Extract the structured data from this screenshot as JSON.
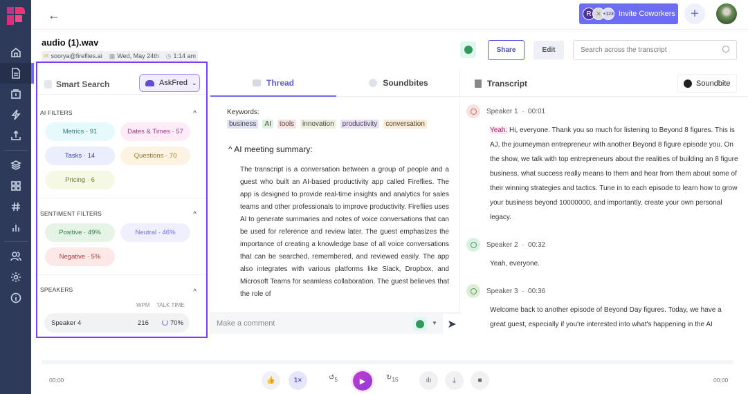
{
  "app": {
    "brand": "Fireflies",
    "accent": "#6c6cf5"
  },
  "sidebar": {
    "items": [
      {
        "name": "home",
        "active": false
      },
      {
        "name": "notebook",
        "active": true
      },
      {
        "name": "meetings",
        "active": false
      },
      {
        "name": "integrations",
        "active": false
      },
      {
        "name": "upload",
        "active": false
      },
      {
        "name": "layers",
        "active": false
      },
      {
        "name": "apps",
        "active": false
      },
      {
        "name": "topics",
        "active": false
      },
      {
        "name": "analytics",
        "active": false
      },
      {
        "name": "team",
        "active": false
      },
      {
        "name": "settings",
        "active": false
      },
      {
        "name": "info",
        "active": false
      }
    ]
  },
  "topbar": {
    "invite_label": "Invite Coworkers",
    "avatar_initial": "R",
    "extra_count": "+123",
    "plus_label": "+"
  },
  "meeting": {
    "title": "audio (1).wav",
    "email": "soorya@fireflies.ai",
    "date": "Wed, May 24th",
    "time": "1:14 am"
  },
  "actions": {
    "share_label": "Share",
    "edit_label": "Edit",
    "search_placeholder": "Search across the transcript"
  },
  "smart_search": {
    "title": "Smart Search",
    "askfred_label": "AskFred",
    "ai_filters_title": "AI FILTERS",
    "ai_filters": [
      {
        "label": "Metrics · 91",
        "bg": "#e6fafc",
        "fg": "#2b7a7a"
      },
      {
        "label": "Dates & Times · 57",
        "bg": "#fdebf8",
        "fg": "#a0338a"
      },
      {
        "label": "Tasks · 14",
        "bg": "#ebeefc",
        "fg": "#3a4aa0"
      },
      {
        "label": "Questions · 70",
        "bg": "#fdf3e3",
        "fg": "#a0762a"
      },
      {
        "label": "Pricing · 6",
        "bg": "#f5f9e3",
        "fg": "#6f7a2a"
      }
    ],
    "sentiment_title": "SENTIMENT FILTERS",
    "sentiment_filters": [
      {
        "label": "Positive · 49%",
        "bg": "#e6f4e8",
        "fg": "#2f7a3f"
      },
      {
        "label": "Neutral · 46%",
        "bg": "#efeffd",
        "fg": "#6c6cf5"
      },
      {
        "label": "Negative · 5%",
        "bg": "#fde8e8",
        "fg": "#b03a3a"
      }
    ],
    "speakers_title": "SPEAKERS",
    "col_wpm": "WPM",
    "col_talk": "TALK TIME",
    "speakers": [
      {
        "name": "Speaker 4",
        "wpm": "216",
        "talk_time": "70%"
      }
    ]
  },
  "thread": {
    "tab_thread": "Thread",
    "tab_soundbites": "Soundbites",
    "keywords_label": "Keywords:",
    "keywords": [
      {
        "text": "business",
        "bg": "#dfe2f2"
      },
      {
        "text": "AI",
        "bg": "#dcf2df"
      },
      {
        "text": "tools",
        "bg": "#fbe0e0"
      },
      {
        "text": "innovation",
        "bg": "#eef0dd"
      },
      {
        "text": "productivity",
        "bg": "#ebe0f7"
      },
      {
        "text": "conversation",
        "bg": "#fcebd2"
      }
    ],
    "summary_heading": "^ AI meeting summary:",
    "summary_text": "The transcript is a conversation between a group of people and a guest who built an AI-based productivity app called Fireflies. The app is designed to provide real-time insights and analytics for sales teams and other professionals to improve productivity. Fireflies uses AI to generate summaries and notes of voice conversations that can be used for reference and review later. The guest emphasizes the importance of creating a knowledge base of all voice conversations that can be searched, remembered, and reviewed easily. The app also integrates with various platforms like Slack, Dropbox, and Microsoft Teams for seamless collaboration. The guest believes that the role of",
    "comment_placeholder": "Make a comment"
  },
  "transcript": {
    "title": "Transcript",
    "soundbite_label": "Soundbite",
    "entries": [
      {
        "speaker": "Speaker 1",
        "time": "00:01",
        "highlight": "Yeah.",
        "text": " Hi, everyone. Thank you so much for listening to Beyond 8 figures. This is AJ, the journeyman entrepreneur with another Beyond 8 figure episode you. On the show, we talk with top entrepreneurs about the realities of building an 8 figure business, what success really means to them and hear from them about some of their winning strategies and tactics. Tune in to each episode to learn how to grow your business beyond 10000000, and importantly, create your own personal legacy.",
        "color": "#f8e1e1",
        "icon_color": "#c96b6b"
      },
      {
        "speaker": "Speaker 2",
        "time": "00:32",
        "highlight": "",
        "text": "Yeah, everyone.",
        "color": "#d9f0e3",
        "icon_color": "#4f8f6a"
      },
      {
        "speaker": "Speaker 3",
        "time": "00:36",
        "highlight": "",
        "text": "Welcome back to another episode of Beyond Day figures. Today, we have a great guest, especially if you're interested into what's happening in the AI",
        "color": "#dcefd6",
        "icon_color": "#5d8f4f"
      }
    ]
  },
  "player": {
    "current_time": "00:00",
    "total_time": "00:00",
    "speed_label": "1×",
    "rewind_label": "5",
    "forward_label": "15",
    "progress": 0
  }
}
